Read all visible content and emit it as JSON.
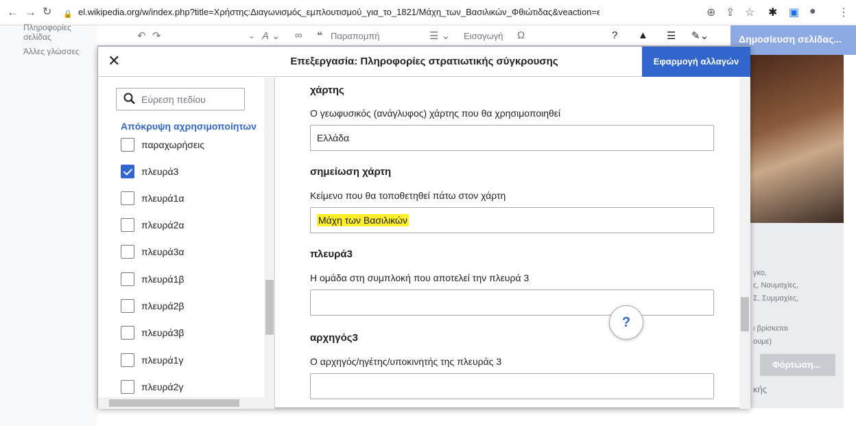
{
  "browser": {
    "url": "el.wikipedia.org/w/index.php?title=Χρήστης:Διαγωνισμός_εμπλουτισμού_για_το_1821/Μάχη_των_Βασιλικών_Φθιώτιδας&veaction=edit&redli..."
  },
  "page": {
    "left_panel": [
      "Πληροφορίες σελίδας",
      "Άλλες γλώσσες"
    ],
    "toolbar": {
      "quote": "Παραπομπή",
      "insert": "Εισαγωγή"
    },
    "publish_label": "Δημοσίευση σελίδας...",
    "right_fragments": [
      "γκο,",
      "ς, Ναυμαχίες,",
      "Σ, Συμμαχίες,",
      "ι βρίσκεται",
      "ουμε)",
      "κής"
    ],
    "load_label": "Φόρτωση..."
  },
  "dialog": {
    "title": "Επεξεργασία: Πληροφορίες στρατιωτικής σύγκρουσης",
    "apply_label": "Εφαρμογή αλλαγών",
    "sidebar": {
      "search_placeholder": "Εύρεση πεδίου",
      "hide_unused": "Απόκρυψη αχρησιμοποίητων",
      "params": [
        {
          "label": "παραχωρήσεις",
          "checked": false
        },
        {
          "label": "πλευρά3",
          "checked": true
        },
        {
          "label": "πλευρά1α",
          "checked": false
        },
        {
          "label": "πλευρά2α",
          "checked": false
        },
        {
          "label": "πλευρά3α",
          "checked": false
        },
        {
          "label": "πλευρά1β",
          "checked": false
        },
        {
          "label": "πλευρά2β",
          "checked": false
        },
        {
          "label": "πλευρά3β",
          "checked": false
        },
        {
          "label": "πλευρά1γ",
          "checked": false
        },
        {
          "label": "πλευρά2γ",
          "checked": false
        }
      ]
    },
    "fields": [
      {
        "name": "χάρτης",
        "desc": "Ο γεωφυσικός (ανάγλυφος) χάρτης που θα χρησιμοποιηθεί",
        "value": "Ελλάδα"
      },
      {
        "name": "σημείωση χάρτη",
        "desc": "Κείμενο που θα τοποθετηθεί πάτω στον χάρτη",
        "value": "Μάχη των Βασιλικών"
      },
      {
        "name": "πλευρά3",
        "desc": "Η ομάδα στη συμπλοκή που αποτελεί την πλευρά 3",
        "value": ""
      },
      {
        "name": "αρχηγός3",
        "desc": "Ο αρχηγός/ηγέτης/υποκινητής της πλευράς 3",
        "value": ""
      }
    ],
    "help_label": "?",
    "highlight_color": "#fcef2a",
    "accent_color": "#3366cc"
  }
}
